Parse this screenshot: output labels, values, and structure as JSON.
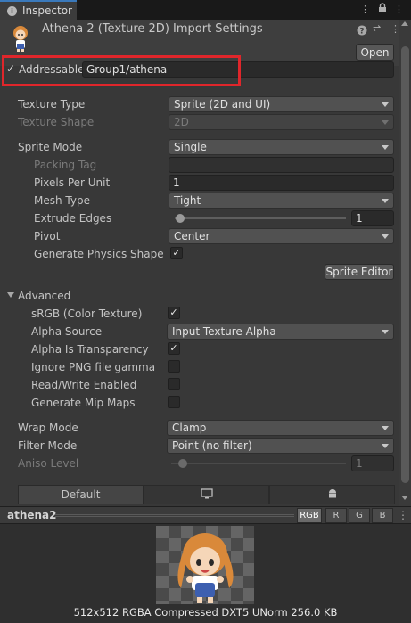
{
  "tab": {
    "label": "Inspector"
  },
  "header": {
    "title": "Athena 2 (Texture 2D) Import Settings",
    "open_label": "Open"
  },
  "addressable": {
    "label": "Addressable",
    "checked": true,
    "value": "Group1/athena"
  },
  "fields": {
    "texture_type": {
      "label": "Texture Type",
      "value": "Sprite (2D and UI)"
    },
    "texture_shape": {
      "label": "Texture Shape",
      "value": "2D"
    },
    "sprite_mode": {
      "label": "Sprite Mode",
      "value": "Single"
    },
    "packing_tag": {
      "label": "Packing Tag",
      "value": ""
    },
    "pixels_per_unit": {
      "label": "Pixels Per Unit",
      "value": "1"
    },
    "mesh_type": {
      "label": "Mesh Type",
      "value": "Tight"
    },
    "extrude_edges": {
      "label": "Extrude Edges",
      "value": "1"
    },
    "pivot": {
      "label": "Pivot",
      "value": "Center"
    },
    "generate_physics_shape": {
      "label": "Generate Physics Shape",
      "checked": true
    },
    "sprite_editor_label": "Sprite Editor"
  },
  "advanced": {
    "label": "Advanced",
    "srgb": {
      "label": "sRGB (Color Texture)",
      "checked": true
    },
    "alpha_source": {
      "label": "Alpha Source",
      "value": "Input Texture Alpha"
    },
    "alpha_is_transparency": {
      "label": "Alpha Is Transparency",
      "checked": true
    },
    "ignore_png_gamma": {
      "label": "Ignore PNG file gamma",
      "checked": false
    },
    "read_write": {
      "label": "Read/Write Enabled",
      "checked": false
    },
    "generate_mip_maps": {
      "label": "Generate Mip Maps",
      "checked": false
    }
  },
  "wrap_mode": {
    "label": "Wrap Mode",
    "value": "Clamp"
  },
  "filter_mode": {
    "label": "Filter Mode",
    "value": "Point (no filter)"
  },
  "aniso_level": {
    "label": "Aniso Level",
    "value": "1"
  },
  "platform_tabs": {
    "default_label": "Default"
  },
  "preview": {
    "name": "athena2",
    "channels": [
      "RGB",
      "R",
      "G",
      "B"
    ],
    "info": "512x512  RGBA Compressed DXT5 UNorm   256.0 KB"
  },
  "icons": [
    "info-icon",
    "kebab-menu-icon",
    "lock-icon",
    "sprite-character-icon",
    "help-icon",
    "settings-icon",
    "monitor-icon",
    "android-icon",
    "collapse-arrow-icon",
    "check-icon"
  ],
  "colors": {
    "highlight": "#e0262b",
    "accent": "#3a79bb"
  }
}
